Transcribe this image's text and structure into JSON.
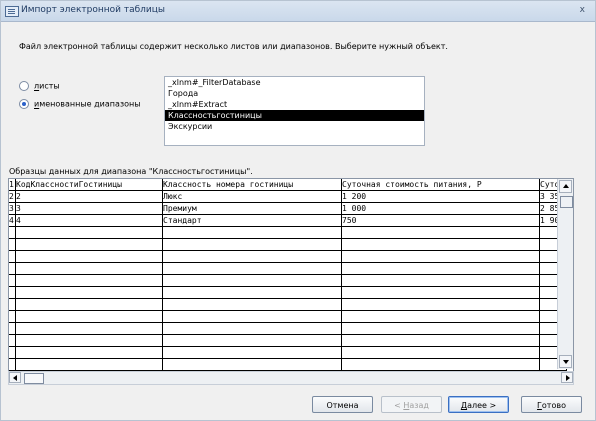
{
  "window": {
    "title": "Импорт электронной таблицы",
    "close_symbol": "x"
  },
  "intro": "Файл электронной таблицы содержит несколько листов или диапазонов.  Выберите нужный объект.",
  "options": {
    "sheets": {
      "accel": "л",
      "rest": "исты",
      "selected": false
    },
    "ranges": {
      "accel": "и",
      "rest": "менованные диапазоны",
      "selected": true
    }
  },
  "ranges_list": [
    {
      "label": "_xlnm#_FilterDatabase",
      "selected": false
    },
    {
      "label": "Города",
      "selected": false
    },
    {
      "label": "_xlnm#Extract",
      "selected": false
    },
    {
      "label": "Классностьгостиницы",
      "selected": true
    },
    {
      "label": "Экскурсии",
      "selected": false
    }
  ],
  "sample_label": "Образцы данных для диапазона \"Классностьгостиницы\".",
  "grid": {
    "headers": [
      "1",
      "КодКлассностиГостиницы",
      "Классность номера гостиницы",
      "Суточная стоимость питания, Р",
      "Суто"
    ],
    "rows": [
      [
        "2",
        "2",
        "Люкс",
        "1 200",
        "3 35"
      ],
      [
        "3",
        "3",
        "Премиум",
        "1 000",
        "2 85"
      ],
      [
        "4",
        "4",
        "Стандарт",
        "750",
        "1 90"
      ]
    ],
    "empty_rows": 12
  },
  "buttons": {
    "cancel": "Отмена",
    "back_prefix": "< ",
    "back_accel": "Н",
    "back_rest": "азад",
    "next_accel": "Д",
    "next_rest": "алее >",
    "finish_accel": "Г",
    "finish_rest": "отово"
  },
  "colors": {
    "title_text": "#203b63",
    "selection": "#000000",
    "accent": "#2b61c9"
  }
}
